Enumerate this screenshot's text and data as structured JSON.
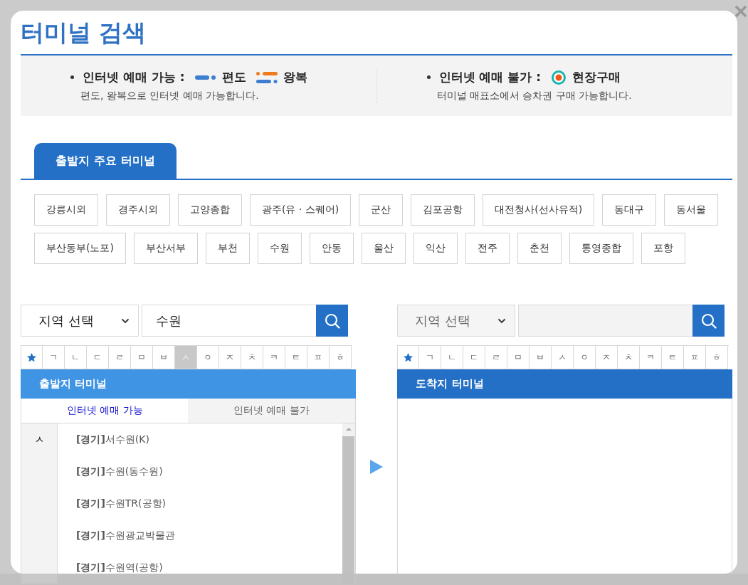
{
  "title": "터미널 검색",
  "legend": [
    {
      "kind": "online",
      "label": "인터넷 예매 가능 :",
      "options": [
        {
          "kind": "oneway",
          "label": "편도"
        },
        {
          "kind": "roundtrip",
          "label": "왕복"
        }
      ],
      "note": "편도, 왕복으로 인터넷 예매 가능합니다."
    },
    {
      "kind": "offline",
      "label": "인터넷 예매 불가 :",
      "options": [
        {
          "kind": "onsite",
          "label": "현장구매"
        }
      ],
      "note": "터미널 매표소에서 승차권 구매 가능합니다."
    }
  ],
  "major_tabs": [
    {
      "label": "출발지 주요 터미널",
      "selected": true
    }
  ],
  "major_terminals": [
    [
      "강릉시외",
      "경주시외",
      "고양종합",
      "광주(유 · 스퀘어)",
      "군산",
      "김포공항",
      "대전청사(선사유적)",
      "동대구",
      "동서울"
    ],
    [
      "부산동부(노포)",
      "부산서부",
      "부천",
      "수원",
      "안동",
      "울산",
      "익산",
      "전주",
      "춘천",
      "통영종합",
      "포항"
    ]
  ],
  "panels": [
    {
      "kind": "departure",
      "disabled": false,
      "region_select": "지역 선택",
      "search_value": "수원",
      "consonants": [
        {
          "kind": "favorite",
          "selected": false
        },
        {
          "kind": "letter",
          "label": "ㄱ",
          "selected": false
        },
        {
          "kind": "letter",
          "label": "ㄴ",
          "selected": false
        },
        {
          "kind": "letter",
          "label": "ㄷ",
          "selected": false
        },
        {
          "kind": "letter",
          "label": "ㄹ",
          "selected": false
        },
        {
          "kind": "letter",
          "label": "ㅁ",
          "selected": false
        },
        {
          "kind": "letter",
          "label": "ㅂ",
          "selected": false
        },
        {
          "kind": "letter",
          "label": "ㅅ",
          "selected": true
        },
        {
          "kind": "letter",
          "label": "ㅇ",
          "selected": false
        },
        {
          "kind": "letter",
          "label": "ㅈ",
          "selected": false
        },
        {
          "kind": "letter",
          "label": "ㅊ",
          "selected": false
        },
        {
          "kind": "letter",
          "label": "ㅋ",
          "selected": false
        },
        {
          "kind": "letter",
          "label": "ㅌ",
          "selected": false
        },
        {
          "kind": "letter",
          "label": "ㅍ",
          "selected": false
        },
        {
          "kind": "letter",
          "label": "ㅎ",
          "selected": false
        }
      ],
      "header": "출발지 터미널",
      "tabs": [
        {
          "label": "인터넷 예매 가능",
          "selected": true
        },
        {
          "label": "인터넷 예매 불가",
          "selected": false
        }
      ],
      "groups": [
        {
          "index": "ㅅ",
          "items": [
            "**[경기]**서수원(K)",
            "**[경기]**수원(동수원)",
            "**[경기]**수원TR(공항)",
            "**[경기]**수원광교박물관",
            "**[경기]**수원역(공항)"
          ]
        }
      ]
    },
    {
      "kind": "arrival",
      "disabled": true,
      "region_select": "지역 선택",
      "consonants": [
        {
          "kind": "favorite",
          "selected": false
        },
        {
          "kind": "letter",
          "label": "ㄱ",
          "selected": false
        },
        {
          "kind": "letter",
          "label": "ㄴ",
          "selected": false
        },
        {
          "kind": "letter",
          "label": "ㄷ",
          "selected": false
        },
        {
          "kind": "letter",
          "label": "ㄹ",
          "selected": false
        },
        {
          "kind": "letter",
          "label": "ㅁ",
          "selected": false
        },
        {
          "kind": "letter",
          "label": "ㅂ",
          "selected": false
        },
        {
          "kind": "letter",
          "label": "ㅅ",
          "selected": false
        },
        {
          "kind": "letter",
          "label": "ㅇ",
          "selected": false
        },
        {
          "kind": "letter",
          "label": "ㅈ",
          "selected": false
        },
        {
          "kind": "letter",
          "label": "ㅊ",
          "selected": false
        },
        {
          "kind": "letter",
          "label": "ㅋ",
          "selected": false
        },
        {
          "kind": "letter",
          "label": "ㅌ",
          "selected": false
        },
        {
          "kind": "letter",
          "label": "ㅍ",
          "selected": false
        },
        {
          "kind": "letter",
          "label": "ㅎ",
          "selected": false
        }
      ],
      "header": "도착지 터미널"
    }
  ]
}
